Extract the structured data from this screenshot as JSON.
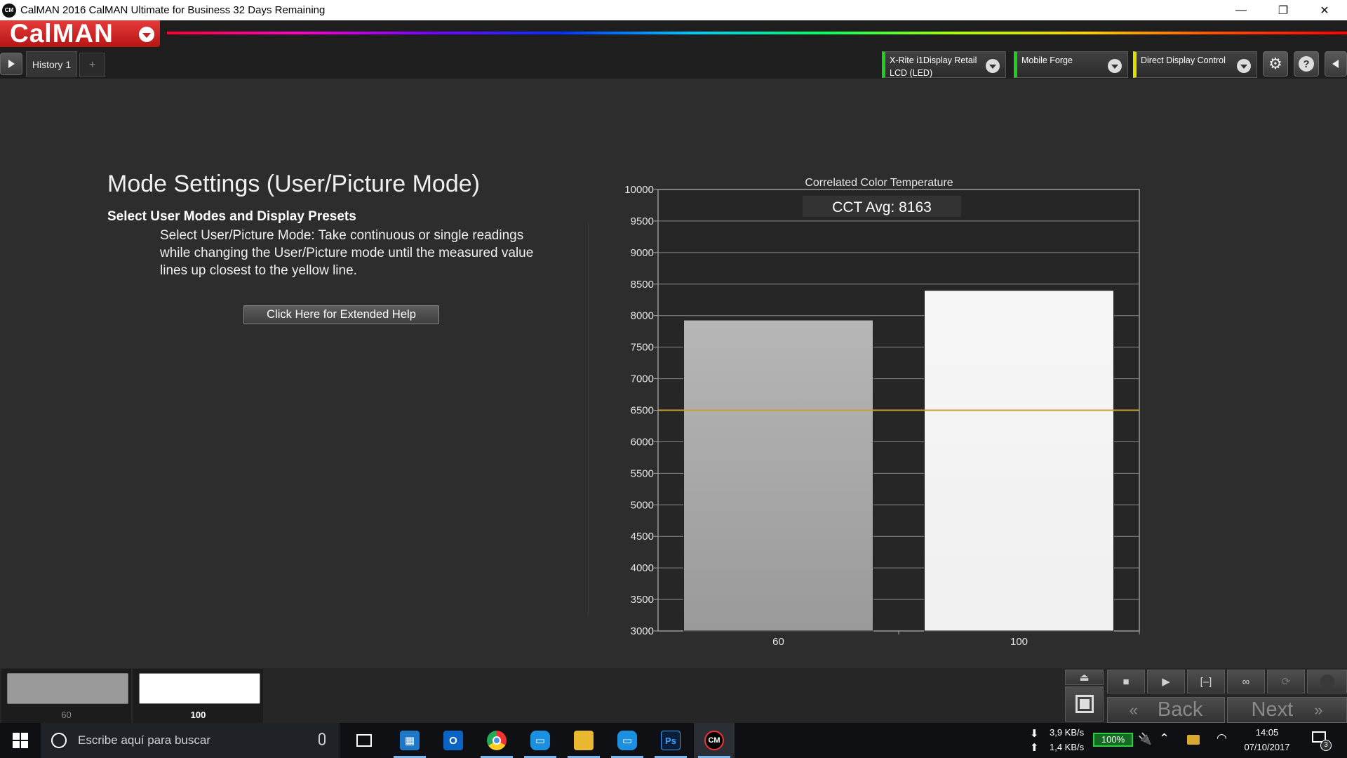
{
  "window": {
    "title": "CalMAN 2016 CalMAN Ultimate for Business 32 Days Remaining",
    "icon_label": "CM",
    "minimize": "—",
    "restore": "❐",
    "close": "✕"
  },
  "header": {
    "logo_text": "CalMAN"
  },
  "tabs": {
    "history_label": "History 1",
    "add_label": "+"
  },
  "devices": [
    {
      "label": "X-Rite i1Display Retail\nLCD (LED)",
      "status_color": "#22cc22"
    },
    {
      "label": "Mobile Forge",
      "status_color": "#22cc22"
    },
    {
      "label": "Direct Display Control",
      "status_color": "#e0e000"
    }
  ],
  "main": {
    "title": "Mode Settings (User/Picture Mode)",
    "subtitle": "Select User Modes and Display Presets",
    "help_text": "Select User/Picture Mode: Take continuous or single readings while changing the User/Picture mode until the measured value lines up closest to the yellow line.",
    "help_button": "Click Here for Extended Help"
  },
  "chart_data": {
    "type": "bar",
    "title": "Correlated Color Temperature",
    "annotation": "CCT Avg: 8163",
    "categories": [
      "60",
      "100"
    ],
    "values": [
      7930,
      8400
    ],
    "bar_colors": [
      "#9a9a9a",
      "#f0f0f0"
    ],
    "ylim": [
      3000,
      10000
    ],
    "yticks": [
      3000,
      3500,
      4000,
      4500,
      5000,
      5500,
      6000,
      6500,
      7000,
      7500,
      8000,
      8500,
      9000,
      9500,
      10000
    ],
    "target_line": 6500,
    "target_color": "#c8a030",
    "grid": true
  },
  "bottom": {
    "thumbnails": [
      {
        "label": "60",
        "color": "#9a9a9a",
        "selected": false
      },
      {
        "label": "100",
        "color": "#ffffff",
        "selected": true
      }
    ],
    "back_label": "Back",
    "next_label": "Next"
  },
  "taskbar": {
    "search_placeholder": "Escribe aquí para buscar",
    "download_speed": "3,9 KB/s",
    "upload_speed": "1,4 KB/s",
    "battery": "100%",
    "time": "14:05",
    "date": "07/10/2017",
    "notification_count": "3",
    "apps": [
      "Store",
      "Outlook",
      "Chrome",
      "Feedback",
      "File Explorer",
      "Skype",
      "Photoshop",
      "CalMAN"
    ]
  }
}
